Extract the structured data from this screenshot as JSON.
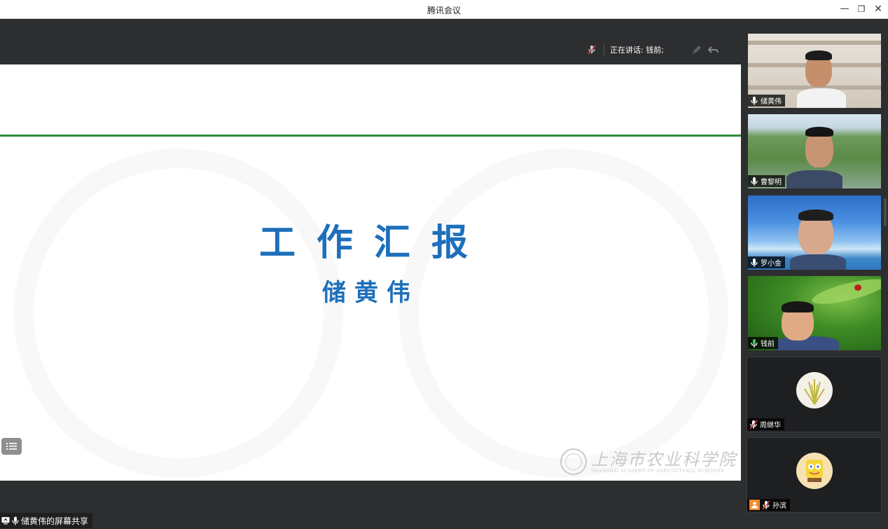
{
  "window": {
    "title": "腾讯会议",
    "min_icon": "minimize-icon",
    "max_icon": "restore-icon",
    "close_icon": "close-icon"
  },
  "speaking": {
    "label": "正在讲话: 钱前;"
  },
  "slide": {
    "title": "工作汇报",
    "presenter": "储黄伟",
    "logo_cn": "上海市农业科学院",
    "logo_en": "SHANGHAI ACADEMY OF AGRICULTURAL SCIENCES",
    "accent": "#1d6fbb",
    "rule_color": "#2f8a3a"
  },
  "share_label": "储黄伟的屏幕共享",
  "participants": [
    {
      "name": "储黄伟",
      "mic": "on",
      "video": true
    },
    {
      "name": "曹黎明",
      "mic": "on",
      "video": true
    },
    {
      "name": "罗小金",
      "mic": "on",
      "video": true
    },
    {
      "name": "钱前",
      "mic": "speaking",
      "video": true
    },
    {
      "name": "周继华",
      "mic": "muted",
      "video": false
    },
    {
      "name": "孙滨",
      "mic": "muted",
      "video": false
    }
  ]
}
